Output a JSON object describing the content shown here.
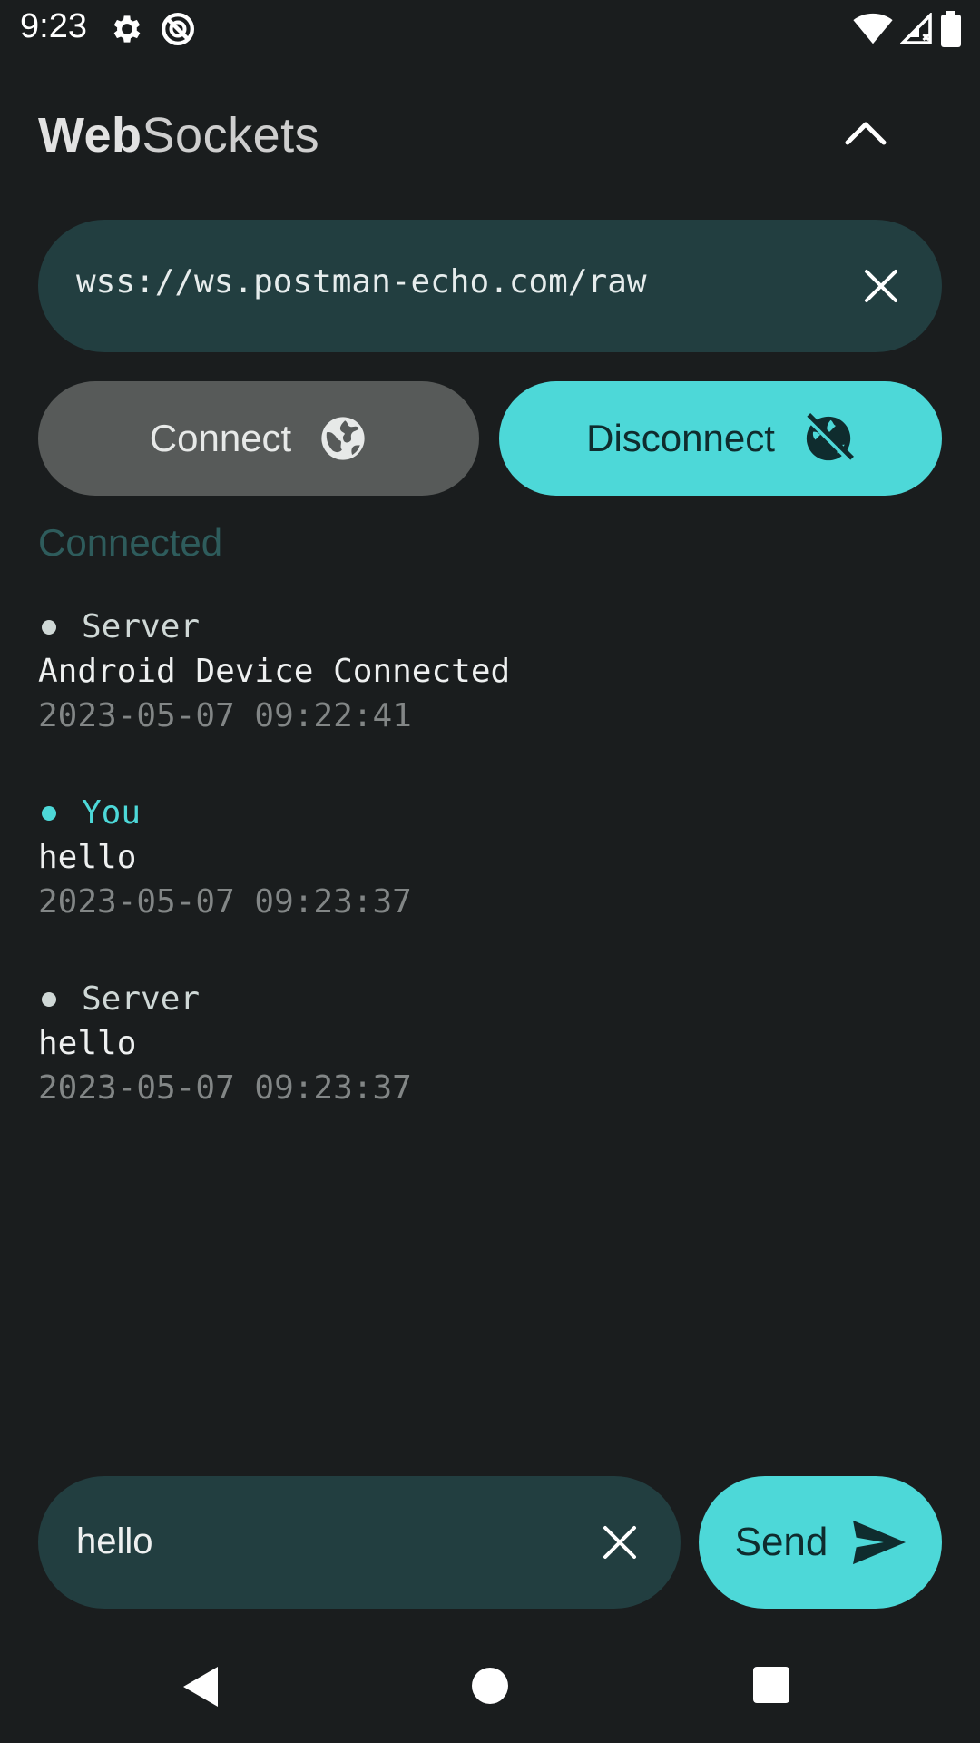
{
  "status_bar": {
    "time": "9:23",
    "icons": [
      "gear-icon",
      "no-sync-icon",
      "wifi-icon",
      "signal-icon",
      "battery-icon"
    ]
  },
  "header": {
    "title_bold": "Web",
    "title_light": "Sockets",
    "collapse_icon": "chevron-up-icon"
  },
  "url_field": {
    "value": "wss://ws.postman-echo.com/raw",
    "clear_icon": "close-icon"
  },
  "actions": {
    "connect_label": "Connect",
    "connect_icon": "globe-icon",
    "disconnect_label": "Disconnect",
    "disconnect_icon": "globe-off-icon"
  },
  "connection_status": "Connected",
  "messages": [
    {
      "sender": "Server",
      "body": "Android Device Connected",
      "time": "2023-05-07 09:22:41"
    },
    {
      "sender": "You",
      "body": "hello",
      "time": "2023-05-07 09:23:37"
    },
    {
      "sender": "Server",
      "body": "hello",
      "time": "2023-05-07 09:23:37"
    }
  ],
  "composer": {
    "value": "hello",
    "clear_icon": "close-icon",
    "send_label": "Send",
    "send_icon": "send-icon"
  },
  "colors": {
    "background": "#1a1d1e",
    "field": "#223e40",
    "accent": "#4dd8d8",
    "muted_button": "#575a59",
    "status_text": "#2e5c5c"
  }
}
